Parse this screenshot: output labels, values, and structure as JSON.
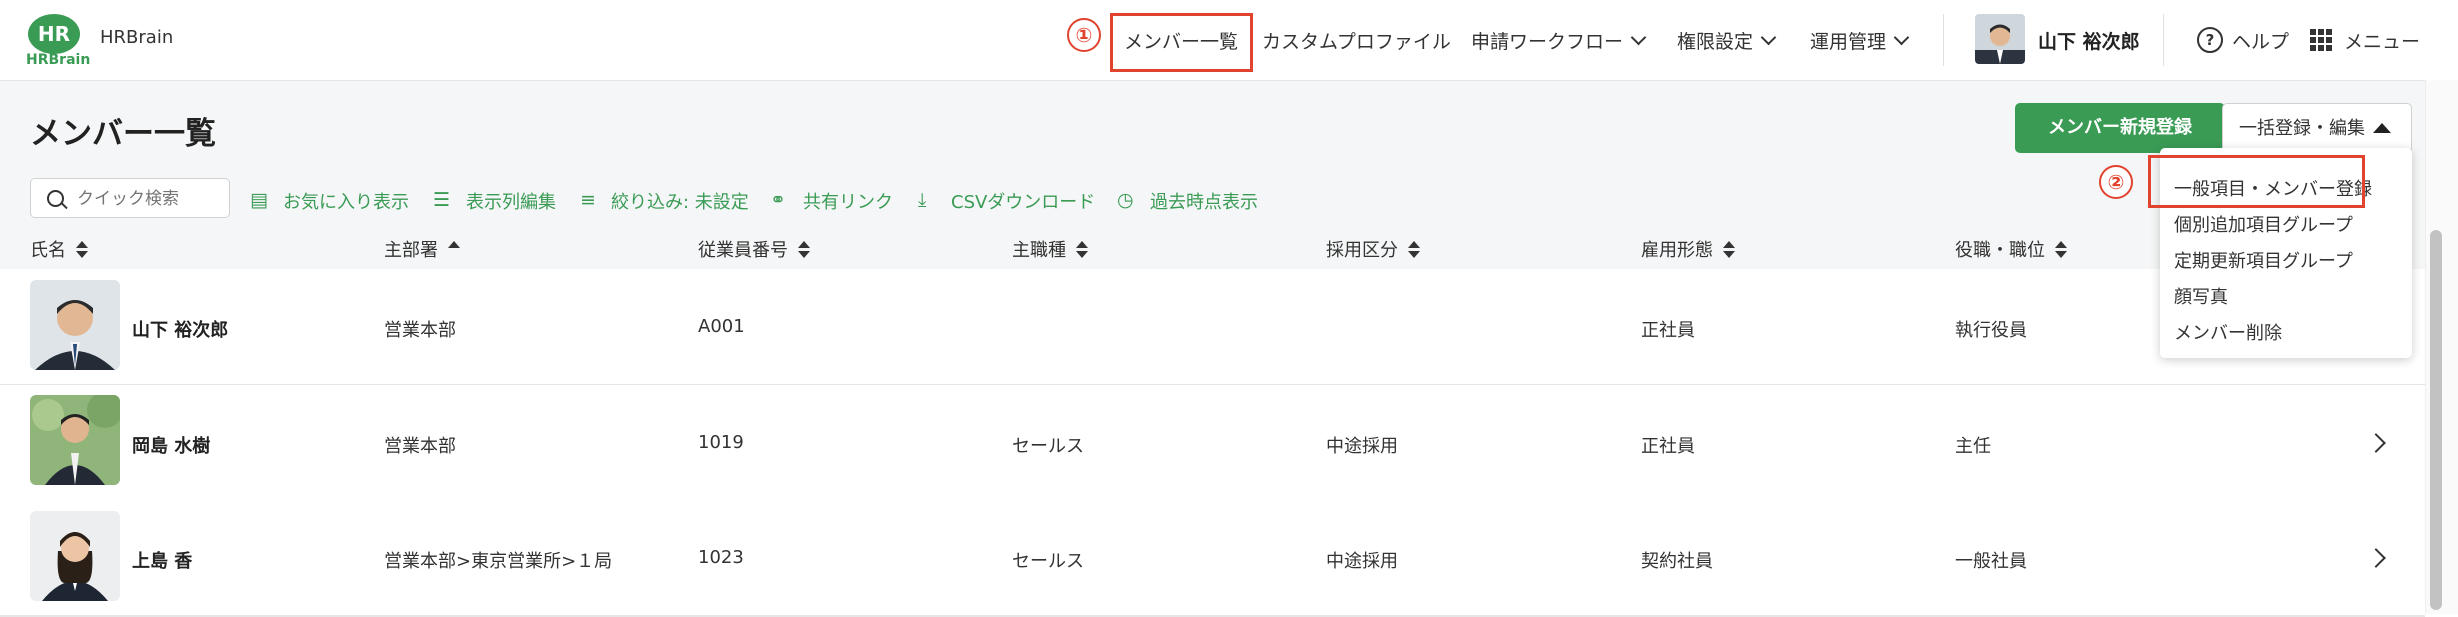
{
  "header": {
    "logo_text": "HR",
    "logo_sub": "HRBrain",
    "app_name": "HRBrain",
    "nav": [
      {
        "label": "メンバー一覧",
        "has_dropdown": false
      },
      {
        "label": "カスタムプロファイル",
        "has_dropdown": false
      },
      {
        "label": "申請ワークフロー",
        "has_dropdown": true
      },
      {
        "label": "権限設定",
        "has_dropdown": true
      },
      {
        "label": "運用管理",
        "has_dropdown": true
      }
    ],
    "user_name": "山下 裕次郎",
    "help_label": "ヘルプ",
    "menu_label": "メニュー"
  },
  "annotations": {
    "step1": "①",
    "step2": "②",
    "color": "#e0432e"
  },
  "page": {
    "title": "メンバー一覧",
    "new_member_button": "メンバー新規登録",
    "bulk_button": "一括登録・編集"
  },
  "toolbar": {
    "search_placeholder": "クイック検索",
    "favorites": "お気に入り表示",
    "edit_columns": "表示列編集",
    "filter": "絞り込み: 未設定",
    "share_link": "共有リンク",
    "csv_download": "CSVダウンロード",
    "past_view": "過去時点表示"
  },
  "table": {
    "columns": [
      "氏名",
      "主部署",
      "従業員番号",
      "主職種",
      "採用区分",
      "雇用形態",
      "役職・職位"
    ],
    "rows": [
      {
        "name": "山下 裕次郎",
        "department": "営業本部",
        "employee_no": "A001",
        "job_type": "",
        "hiring": "",
        "employment": "正社員",
        "position": "執行役員"
      },
      {
        "name": "岡島 水樹",
        "department": "営業本部",
        "employee_no": "1019",
        "job_type": "セールス",
        "hiring": "中途採用",
        "employment": "正社員",
        "position": "主任"
      },
      {
        "name": "上島 香",
        "department": "営業本部>東京営業所>１局",
        "employee_no": "1023",
        "job_type": "セールス",
        "hiring": "中途採用",
        "employment": "契約社員",
        "position": "一般社員"
      }
    ]
  },
  "dropdown": {
    "items": [
      "一般項目・メンバー登録",
      "個別追加項目グループ",
      "定期更新項目グループ",
      "顔写真",
      "メンバー削除"
    ]
  },
  "colors": {
    "brand_green": "#3a9b55",
    "annotation_red": "#e0432e"
  }
}
